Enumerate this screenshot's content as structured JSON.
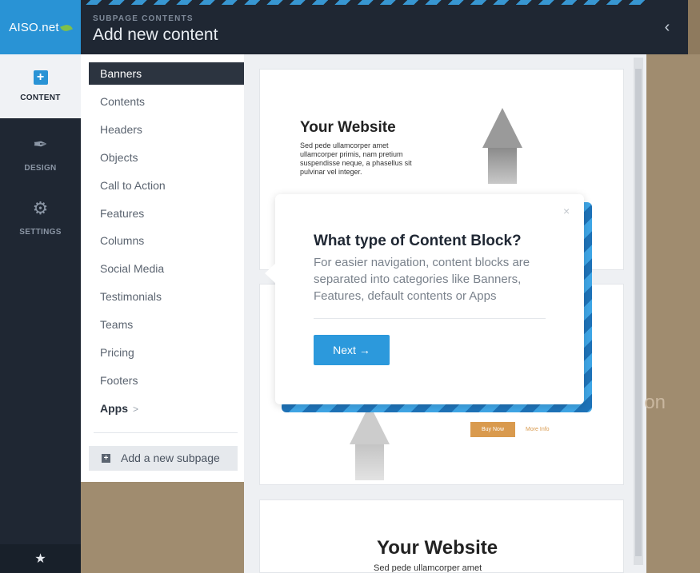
{
  "header": {
    "logo_text": "AISO.net",
    "subtitle": "SUBPAGE CONTENTS",
    "title": "Add new content",
    "collapse_icon": "chevron-left-icon"
  },
  "rail": {
    "items": [
      {
        "label": "CONTENT",
        "icon": "plus-square-icon"
      },
      {
        "label": "DESIGN",
        "icon": "brush-icon"
      },
      {
        "label": "SETTINGS",
        "icon": "gears-icon"
      }
    ],
    "bottom_icon": "star-icon"
  },
  "categories": {
    "items": [
      "Banners",
      "Contents",
      "Headers",
      "Objects",
      "Call to Action",
      "Features",
      "Columns",
      "Social Media",
      "Testimonials",
      "Teams",
      "Pricing",
      "Footers",
      "Apps"
    ],
    "apps_chevron": ">",
    "add_subpage": "Add a new subpage"
  },
  "preview": {
    "card1_title": "Your Website",
    "card1_body": "Sed pede ullamcorper amet ullamcorper primis, nam pretium suspendisse neque, a phasellus sit pulvinar vel integer.",
    "buy_now": "Buy Now",
    "more_info": "More Info",
    "card3_title": "Your Website",
    "card3_body": "Sed pede ullamcorper amet",
    "right_faded": "ion"
  },
  "modal": {
    "title": "What type of Content Block?",
    "text": "For easier navigation, content blocks are separated into categories like Banners, Features, default contents or Apps",
    "next_label": "Next →",
    "close": "×"
  },
  "colors": {
    "accent": "#2993d5",
    "dark": "#1f2733",
    "button": "#2c99dc"
  }
}
